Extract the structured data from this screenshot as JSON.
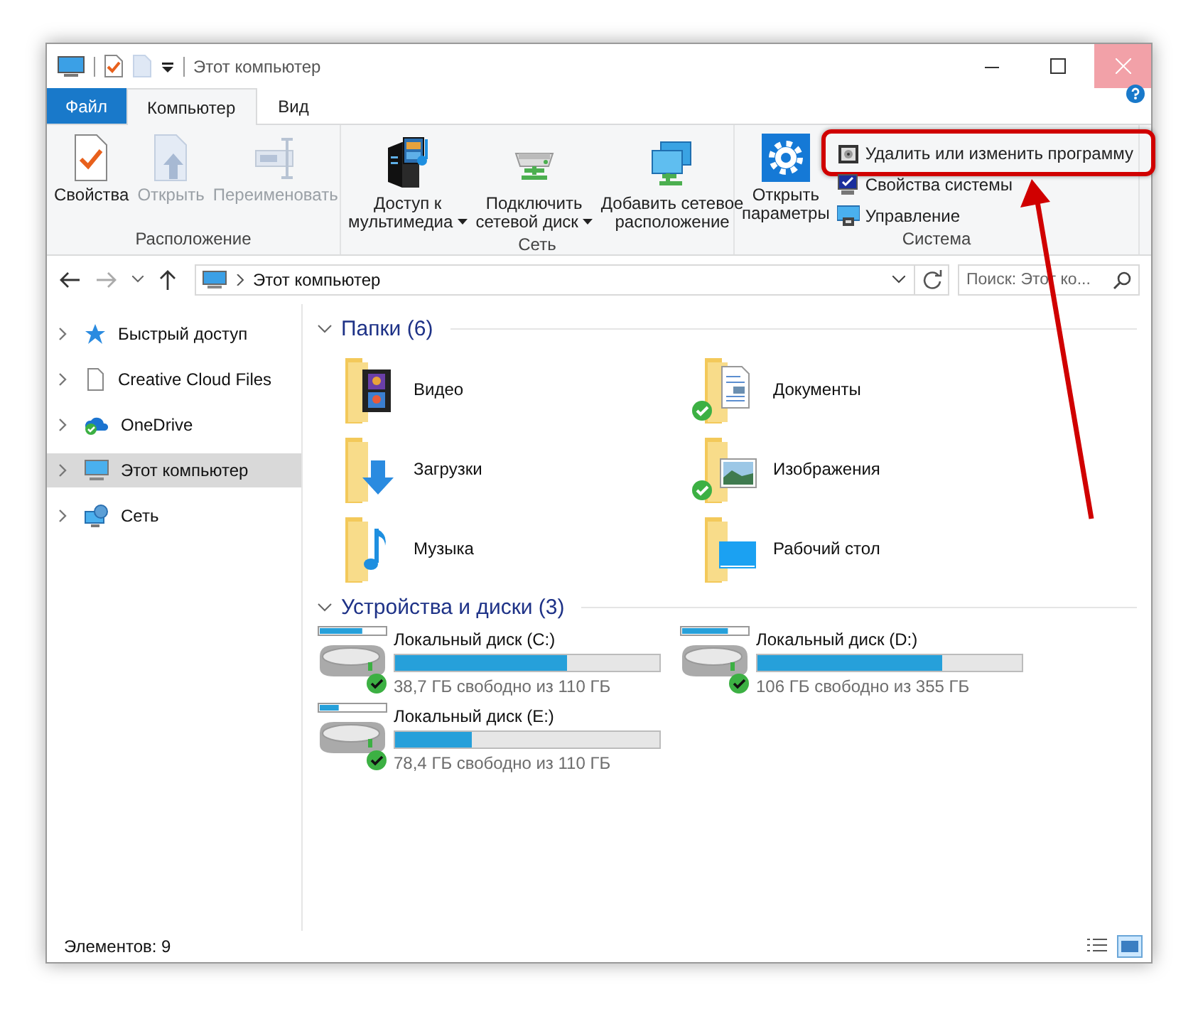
{
  "window": {
    "title": "Этот компьютер"
  },
  "tabs": [
    {
      "label": "Файл",
      "kind": "file",
      "selected": false
    },
    {
      "label": "Компьютер",
      "kind": "tab",
      "selected": true
    },
    {
      "label": "Вид",
      "kind": "tab",
      "selected": false
    }
  ],
  "ribbon": {
    "groups": [
      {
        "label": "Расположение",
        "buttons": [
          {
            "lines": [
              "Свойства"
            ],
            "kind": "properties",
            "disabled": false,
            "dropdown": false
          },
          {
            "lines": [
              "Открыть"
            ],
            "kind": "open",
            "disabled": true,
            "dropdown": false
          },
          {
            "lines": [
              "Переименовать"
            ],
            "kind": "rename",
            "disabled": true,
            "dropdown": false
          }
        ]
      },
      {
        "label": "Сеть",
        "buttons": [
          {
            "lines": [
              "Доступ к",
              "мультимедиа"
            ],
            "kind": "media",
            "disabled": false,
            "dropdown": true
          },
          {
            "lines": [
              "Подключить",
              "сетевой диск"
            ],
            "kind": "mapdrive",
            "disabled": false,
            "dropdown": true
          },
          {
            "lines": [
              "Добавить сетевое",
              "расположение"
            ],
            "kind": "netloc",
            "disabled": false,
            "dropdown": false
          }
        ]
      },
      {
        "label": "Система",
        "buttons": [
          {
            "lines": [
              "Открыть",
              "параметры"
            ],
            "kind": "settings",
            "disabled": false,
            "dropdown": false
          }
        ],
        "small": [
          {
            "label": "Удалить или изменить программу",
            "kind": "uninstall",
            "highlighted": true
          },
          {
            "label": "Свойства системы",
            "kind": "sysprops",
            "highlighted": false
          },
          {
            "label": "Управление",
            "kind": "manage",
            "highlighted": false
          }
        ]
      }
    ]
  },
  "address": {
    "path": "Этот компьютер",
    "search_placeholder": "Поиск: Этот ко..."
  },
  "sidebar": {
    "items": [
      {
        "label": "Быстрый доступ",
        "kind": "star",
        "selected": false
      },
      {
        "label": "Creative Cloud Files",
        "kind": "file",
        "selected": false
      },
      {
        "label": "OneDrive",
        "kind": "cloud",
        "selected": false
      },
      {
        "label": "Этот компьютер",
        "kind": "pc",
        "selected": true
      },
      {
        "label": "Сеть",
        "kind": "network",
        "selected": false
      }
    ]
  },
  "folders": {
    "title": "Папки (6)",
    "items": [
      {
        "name": "Видео",
        "kind": "video",
        "synced": false
      },
      {
        "name": "Документы",
        "kind": "docs",
        "synced": true
      },
      {
        "name": "Загрузки",
        "kind": "downloads",
        "synced": false
      },
      {
        "name": "Изображения",
        "kind": "pictures",
        "synced": true
      },
      {
        "name": "Музыка",
        "kind": "music",
        "synced": false
      },
      {
        "name": "Рабочий стол",
        "kind": "desktop",
        "synced": false
      }
    ]
  },
  "drives": {
    "title": "Устройства и диски (3)",
    "items": [
      {
        "name": "Локальный диск (C:)",
        "level": 0.65,
        "free": "38,7 ГБ свободно из 110 ГБ"
      },
      {
        "name": "Локальный диск (D:)",
        "level": 0.7,
        "free": "106 ГБ свободно из 355 ГБ"
      },
      {
        "name": "Локальный диск (E:)",
        "level": 0.29,
        "free": "78,4 ГБ свободно из 110 ГБ"
      }
    ]
  },
  "status_bar": {
    "items_count": "Элементов: 9"
  }
}
